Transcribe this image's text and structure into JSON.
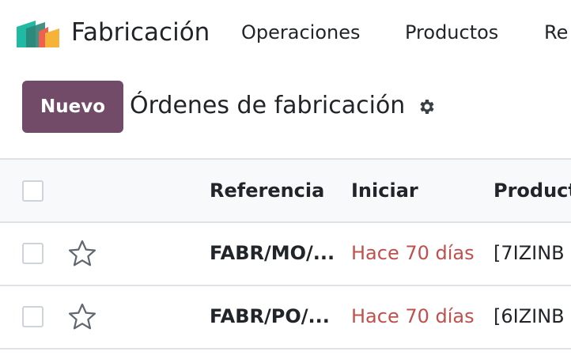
{
  "nav": {
    "app_name": "Fabricación",
    "menu": [
      "Operaciones",
      "Productos",
      "Re"
    ]
  },
  "control": {
    "new_label": "Nuevo",
    "title": "Órdenes de fabricación"
  },
  "table": {
    "headers": [
      "Referencia",
      "Iniciar",
      "Product"
    ],
    "rows": [
      {
        "reference": "FABR/MO/...",
        "start": "Hace 70 días",
        "product": "[7IZINB"
      },
      {
        "reference": "FABR/PO/...",
        "start": "Hace 70 días",
        "product": "[6IZINB"
      }
    ]
  },
  "colors": {
    "primary": "#714B67",
    "overdue": "#c0504d"
  }
}
